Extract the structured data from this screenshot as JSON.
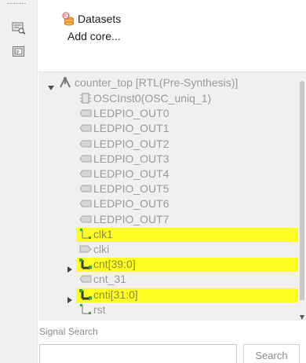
{
  "top_panel": {
    "items": [
      {
        "label": "Datasets",
        "icon": "datasets-icon"
      },
      {
        "label": "Add core...",
        "icon": ""
      }
    ]
  },
  "tree": {
    "root": {
      "label": "counter_top [RTL(Pre-Synthesis)]",
      "icon": "hierarchy-icon",
      "expanded": true
    },
    "rows": [
      {
        "label": "OSCInst0(OSC_uniq_1)",
        "icon": "chip-icon",
        "highlight": false,
        "expandable": false
      },
      {
        "label": "LEDPIO_OUT0",
        "icon": "output-port-icon",
        "highlight": false,
        "expandable": false
      },
      {
        "label": "LEDPIO_OUT1",
        "icon": "output-port-icon",
        "highlight": false,
        "expandable": false
      },
      {
        "label": "LEDPIO_OUT2",
        "icon": "output-port-icon",
        "highlight": false,
        "expandable": false
      },
      {
        "label": "LEDPIO_OUT3",
        "icon": "output-port-icon",
        "highlight": false,
        "expandable": false
      },
      {
        "label": "LEDPIO_OUT4",
        "icon": "output-port-icon",
        "highlight": false,
        "expandable": false
      },
      {
        "label": "LEDPIO_OUT5",
        "icon": "output-port-icon",
        "highlight": false,
        "expandable": false
      },
      {
        "label": "LEDPIO_OUT6",
        "icon": "output-port-icon",
        "highlight": false,
        "expandable": false
      },
      {
        "label": "LEDPIO_OUT7",
        "icon": "output-port-icon",
        "highlight": false,
        "expandable": false
      },
      {
        "label": "clk1",
        "icon": "net-icon",
        "highlight": true,
        "expandable": false
      },
      {
        "label": "clki",
        "icon": "input-port-icon",
        "highlight": false,
        "expandable": false
      },
      {
        "label": "cnt[39:0]",
        "icon": "bus-net-icon",
        "highlight": true,
        "expandable": true
      },
      {
        "label": "cnt_31",
        "icon": "output-port-icon",
        "highlight": false,
        "expandable": false
      },
      {
        "label": "cnti[31:0]",
        "icon": "bus-net-icon",
        "highlight": true,
        "expandable": true
      },
      {
        "label": "rst",
        "icon": "net-icon",
        "highlight": false,
        "expandable": false
      }
    ]
  },
  "signal_search": {
    "label": "Signal Search",
    "input_value": "",
    "button_label": "Search"
  },
  "colors": {
    "highlight": "#ffff22",
    "tree_bg": "#f0f0f0",
    "grey_text": "#9a9a9a"
  }
}
